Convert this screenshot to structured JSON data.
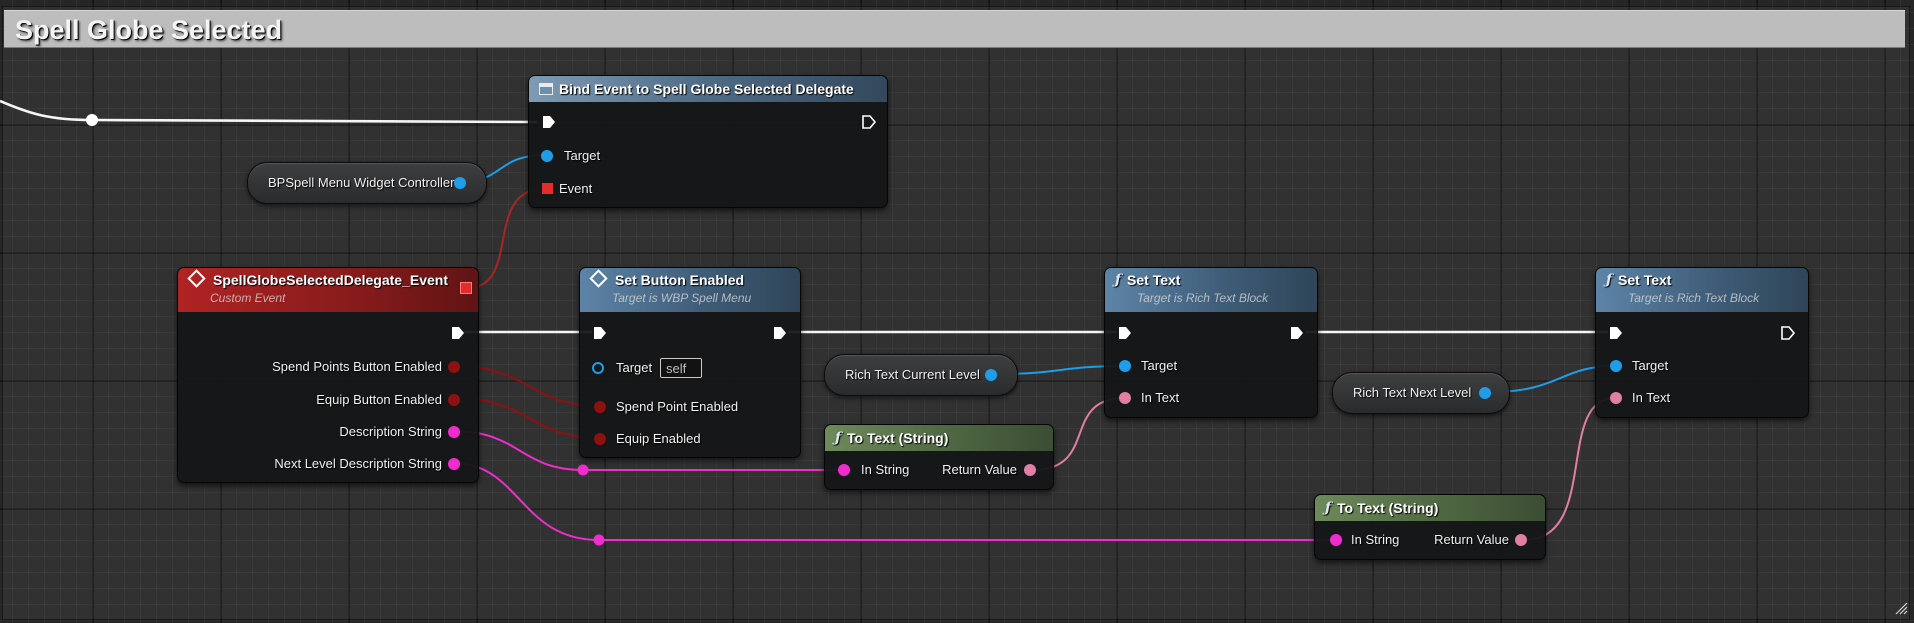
{
  "comment": {
    "title": "Spell Globe Selected"
  },
  "colors": {
    "exec_wire": "#ffffff",
    "object_pin": "#1f9de8",
    "bool_pin": "#8f1010",
    "string_pin": "#f12ccf",
    "text_pin": "#e07fa6",
    "delegate_pin": "#e32d2d"
  },
  "nodes": {
    "bind_event": {
      "title": "Bind Event to Spell Globe Selected Delegate",
      "icon": "event-bind-icon",
      "pins": {
        "target": "Target",
        "event": "Event"
      }
    },
    "custom_event": {
      "title": "SpellGlobeSelectedDelegate_Event",
      "subtitle": "Custom Event",
      "icon": "diamond-event-icon",
      "pins": {
        "spend_points": "Spend Points Button Enabled",
        "equip": "Equip Button Enabled",
        "description": "Description String",
        "next_level": "Next Level Description String"
      }
    },
    "set_button_enabled": {
      "title": "Set Button Enabled",
      "subtitle": "Target is WBP Spell Menu",
      "icon": "diamond-function-icon",
      "pins": {
        "target": "Target",
        "target_default": "self",
        "spend_point": "Spend Point Enabled",
        "equip": "Equip Enabled"
      }
    },
    "set_text_1": {
      "title": "Set Text",
      "subtitle": "Target is Rich Text Block",
      "icon": "function-icon",
      "pins": {
        "target": "Target",
        "in_text": "In Text"
      }
    },
    "set_text_2": {
      "title": "Set Text",
      "subtitle": "Target is Rich Text Block",
      "icon": "function-icon",
      "pins": {
        "target": "Target",
        "in_text": "In Text"
      }
    },
    "to_text_1": {
      "title": "To Text (String)",
      "icon": "function-icon",
      "pins": {
        "in_string": "In String",
        "return_value": "Return Value"
      }
    },
    "to_text_2": {
      "title": "To Text (String)",
      "icon": "function-icon",
      "pins": {
        "in_string": "In String",
        "return_value": "Return Value"
      }
    },
    "var_controller": {
      "label": "BPSpell Menu Widget Controller"
    },
    "var_current_level": {
      "label": "Rich Text Current Level"
    },
    "var_next_level": {
      "label": "Rich Text Next Level"
    }
  }
}
